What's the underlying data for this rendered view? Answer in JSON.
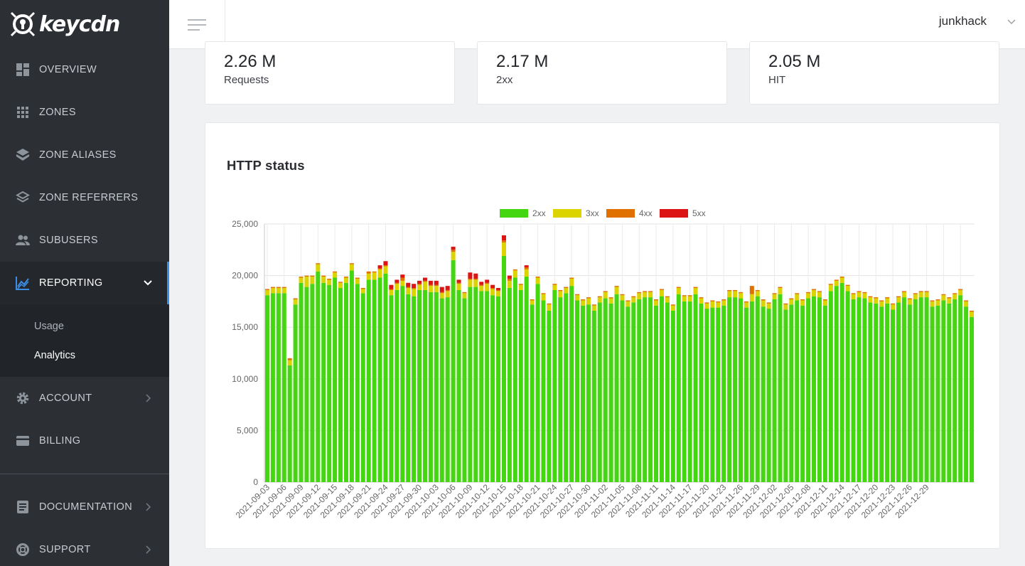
{
  "brand": {
    "name": "keycdn"
  },
  "sidebar": {
    "items": [
      {
        "label": "OVERVIEW",
        "icon": "dashboard-icon"
      },
      {
        "label": "ZONES",
        "icon": "grid-icon"
      },
      {
        "label": "ZONE ALIASES",
        "icon": "layers-icon"
      },
      {
        "label": "ZONE REFERRERS",
        "icon": "layers-outline-icon"
      },
      {
        "label": "SUBUSERS",
        "icon": "people-icon"
      },
      {
        "label": "REPORTING",
        "icon": "chart-line-icon"
      },
      {
        "label": "ACCOUNT",
        "icon": "gear-icon"
      },
      {
        "label": "BILLING",
        "icon": "credit-card-icon"
      },
      {
        "label": "DOCUMENTATION",
        "icon": "document-icon"
      },
      {
        "label": "SUPPORT",
        "icon": "lifebuoy-icon"
      }
    ],
    "reporting_sub": [
      {
        "label": "Usage"
      },
      {
        "label": "Analytics"
      }
    ]
  },
  "topbar": {
    "username": "junkhack"
  },
  "stats": [
    {
      "value": "2.26 M",
      "label": "Requests"
    },
    {
      "value": "2.17 M",
      "label": "2xx"
    },
    {
      "value": "2.05 M",
      "label": "HIT"
    }
  ],
  "chart_card": {
    "title": "HTTP status"
  },
  "colors": {
    "2xx": "#44d611",
    "3xx": "#dcd400",
    "4xx": "#e07000",
    "5xx": "#dc1414",
    "accent": "#3a8ee6"
  },
  "chart_data": {
    "type": "bar",
    "stacked": true,
    "start_date": "2021-09-03",
    "xtick_every": 3,
    "ylim": [
      0,
      25000
    ],
    "yticks": [
      "0",
      "5,000",
      "10,000",
      "15,000",
      "20,000",
      "25,000"
    ],
    "xtick_labels": [
      "2021-09-03",
      "2021-09-06",
      "2021-09-09",
      "2021-09-12",
      "2021-09-15",
      "2021-09-18",
      "2021-09-21",
      "2021-09-24",
      "2021-09-27",
      "2021-09-30",
      "2021-10-03",
      "2021-10-06",
      "2021-10-09",
      "2021-10-12",
      "2021-10-15",
      "2021-10-18",
      "2021-10-21",
      "2021-10-24",
      "2021-10-27",
      "2021-10-30",
      "2021-11-02",
      "2021-11-05",
      "2021-11-08",
      "2021-11-11",
      "2021-11-14",
      "2021-11-17",
      "2021-11-20",
      "2021-11-23",
      "2021-11-26",
      "2021-11-29",
      "2021-12-02",
      "2021-12-05",
      "2021-12-08",
      "2021-12-11",
      "2021-12-14",
      "2021-12-17",
      "2021-12-20",
      "2021-12-23",
      "2021-12-26",
      "2021-12-29"
    ],
    "legend_position": "top",
    "series": [
      {
        "name": "2xx",
        "values": [
          18100,
          18300,
          18300,
          18300,
          11300,
          17200,
          19300,
          18900,
          19200,
          20400,
          19300,
          19100,
          19800,
          18800,
          19300,
          20500,
          19200,
          18300,
          19600,
          19600,
          19800,
          20200,
          18100,
          18600,
          19000,
          18200,
          18000,
          18600,
          18600,
          18400,
          18400,
          17800,
          17900,
          21500,
          18600,
          17800,
          18900,
          18900,
          18500,
          18500,
          18100,
          18000,
          21900,
          18800,
          19800,
          18600,
          19900,
          17200,
          19200,
          17600,
          16600,
          18600,
          17900,
          18300,
          19000,
          17600,
          17100,
          17200,
          16600,
          17400,
          17800,
          17300,
          18200,
          17600,
          17000,
          17400,
          17700,
          17900,
          17900,
          17100,
          18000,
          17400,
          16600,
          18200,
          17500,
          17500,
          18200,
          17300,
          16800,
          16900,
          16900,
          17100,
          17900,
          17900,
          17800,
          16900,
          17500,
          18000,
          17000,
          16800,
          17700,
          18200,
          16700,
          17200,
          17600,
          17100,
          17800,
          18000,
          17900,
          17100,
          18500,
          19000,
          19300,
          18500,
          17700,
          17900,
          17800,
          17400,
          17300,
          17000,
          17300,
          16700,
          17400,
          17900,
          17200,
          17700,
          17900,
          17900,
          17000,
          17100,
          17600,
          17300,
          17700,
          18100,
          17000,
          16000
        ]
      },
      {
        "name": "3xx",
        "values": [
          500,
          500,
          500,
          500,
          500,
          500,
          500,
          1000,
          700,
          700,
          600,
          500,
          500,
          500,
          500,
          600,
          500,
          400,
          600,
          700,
          800,
          700,
          500,
          600,
          500,
          600,
          700,
          500,
          800,
          600,
          600,
          500,
          600,
          800,
          600,
          500,
          700,
          700,
          500,
          700,
          600,
          500,
          1300,
          700,
          700,
          500,
          700,
          400,
          600,
          600,
          600,
          500,
          600,
          500,
          700,
          500,
          500,
          600,
          500,
          500,
          600,
          500,
          700,
          500,
          500,
          500,
          600,
          500,
          500,
          500,
          600,
          500,
          500,
          600,
          500,
          500,
          600,
          500,
          500,
          600,
          500,
          500,
          600,
          600,
          500,
          500,
          700,
          500,
          600,
          500,
          500,
          600,
          500,
          500,
          600,
          500,
          500,
          600,
          500,
          500,
          600,
          500,
          500,
          500,
          500,
          500,
          500,
          500,
          500,
          500,
          500,
          500,
          500,
          500,
          500,
          500,
          500,
          500,
          500,
          500,
          500,
          500,
          500,
          500,
          500,
          500
        ]
      },
      {
        "name": "4xx",
        "values": [
          100,
          100,
          100,
          100,
          200,
          100,
          100,
          100,
          100,
          100,
          100,
          100,
          100,
          100,
          100,
          100,
          100,
          100,
          200,
          100,
          100,
          100,
          100,
          100,
          300,
          100,
          100,
          100,
          100,
          100,
          100,
          100,
          100,
          200,
          100,
          100,
          100,
          100,
          100,
          100,
          100,
          100,
          200,
          200,
          100,
          100,
          200,
          100,
          100,
          100,
          100,
          100,
          100,
          100,
          100,
          100,
          100,
          100,
          100,
          100,
          100,
          100,
          100,
          100,
          100,
          100,
          100,
          100,
          100,
          100,
          100,
          100,
          100,
          100,
          100,
          100,
          100,
          100,
          100,
          100,
          100,
          100,
          100,
          100,
          100,
          100,
          800,
          100,
          100,
          100,
          100,
          100,
          100,
          100,
          100,
          100,
          100,
          100,
          100,
          100,
          100,
          100,
          100,
          100,
          100,
          100,
          100,
          100,
          100,
          100,
          100,
          100,
          100,
          100,
          100,
          100,
          100,
          100,
          100,
          100,
          100,
          100,
          100,
          100,
          100,
          100
        ]
      },
      {
        "name": "5xx",
        "values": [
          0,
          0,
          0,
          0,
          0,
          0,
          0,
          0,
          0,
          0,
          0,
          0,
          0,
          0,
          0,
          0,
          0,
          0,
          0,
          0,
          300,
          400,
          400,
          300,
          300,
          400,
          400,
          300,
          300,
          400,
          400,
          500,
          400,
          300,
          300,
          0,
          600,
          500,
          300,
          300,
          300,
          200,
          500,
          300,
          0,
          0,
          200,
          0,
          0,
          0,
          0,
          0,
          0,
          0,
          0,
          0,
          0,
          0,
          0,
          0,
          0,
          0,
          0,
          0,
          0,
          0,
          0,
          0,
          0,
          0,
          0,
          0,
          0,
          0,
          0,
          0,
          0,
          0,
          0,
          0,
          0,
          0,
          0,
          0,
          0,
          0,
          0,
          0,
          0,
          0,
          0,
          0,
          0,
          0,
          0,
          0,
          0,
          0,
          0,
          0,
          0,
          0,
          0,
          0,
          0,
          0,
          0,
          0,
          0,
          0,
          0,
          0,
          0,
          0,
          0,
          0,
          0,
          0,
          0,
          0,
          0,
          0,
          0,
          0,
          0,
          0
        ]
      }
    ]
  }
}
